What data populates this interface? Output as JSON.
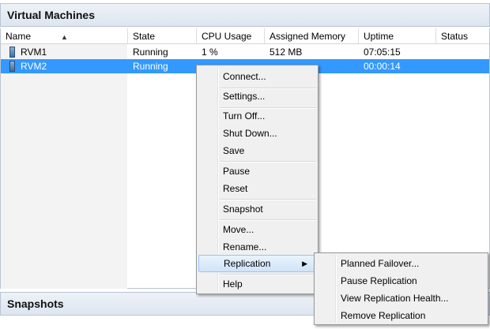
{
  "panels": {
    "virtual_machines_title": "Virtual Machines",
    "snapshots_title": "Snapshots"
  },
  "columns": {
    "name": "Name",
    "state": "State",
    "cpu": "CPU Usage",
    "memory": "Assigned Memory",
    "uptime": "Uptime",
    "status": "Status",
    "sort_indicator": "▲"
  },
  "rows": [
    {
      "name": "RVM1",
      "state": "Running",
      "cpu": "1 %",
      "memory": "512 MB",
      "uptime": "07:05:15",
      "status": ""
    },
    {
      "name": "RVM2",
      "state": "Running",
      "cpu": "",
      "memory": "",
      "uptime": "00:00:14",
      "status": ""
    }
  ],
  "context_menu": {
    "connect": "Connect...",
    "settings": "Settings...",
    "turn_off": "Turn Off...",
    "shut_down": "Shut Down...",
    "save": "Save",
    "pause": "Pause",
    "reset": "Reset",
    "snapshot": "Snapshot",
    "move": "Move...",
    "rename": "Rename...",
    "replication": "Replication",
    "submenu_arrow": "▶",
    "help": "Help"
  },
  "replication_submenu": {
    "planned_failover": "Planned Failover...",
    "pause_replication": "Pause Replication",
    "view_health": "View Replication Health...",
    "remove_replication": "Remove Replication"
  },
  "colors": {
    "selection": "#3399ff",
    "menu_background": "#f0f0f0",
    "menu_highlight": "#cfe4fa"
  },
  "icons": {
    "vm": "virtual-machine-icon"
  }
}
